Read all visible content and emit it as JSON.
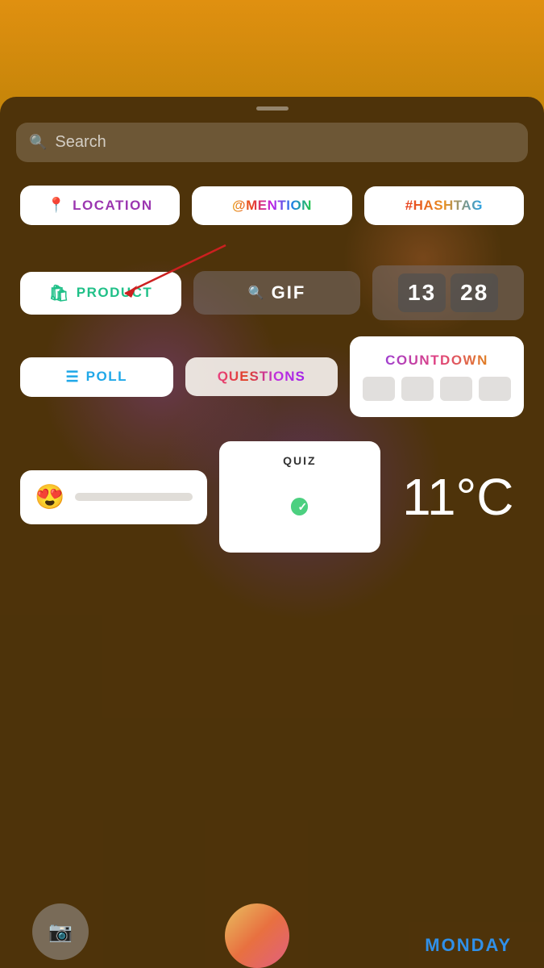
{
  "topBar": {
    "height": 120
  },
  "dragHandle": {},
  "search": {
    "placeholder": "Search",
    "icon": "🔍"
  },
  "stickers": {
    "row1": [
      {
        "id": "location",
        "label": "LOCATION",
        "icon": "📍",
        "type": "location"
      },
      {
        "id": "mention",
        "label": "@MENTION",
        "type": "mention"
      },
      {
        "id": "hashtag",
        "label": "#HASHTAG",
        "type": "hashtag"
      }
    ],
    "row2": [
      {
        "id": "product",
        "label": "PRODUCT",
        "icon": "🛍",
        "type": "product"
      },
      {
        "id": "gif",
        "label": "GIF",
        "type": "gif"
      },
      {
        "id": "timer",
        "digits1": "13",
        "digits2": "28",
        "type": "timer"
      }
    ],
    "row3": [
      {
        "id": "poll",
        "label": "POLL",
        "icon": "≡",
        "type": "poll"
      },
      {
        "id": "questions",
        "label": "QUESTIONS",
        "type": "questions"
      },
      {
        "id": "countdown",
        "label": "COUNTDOWN",
        "type": "countdown"
      }
    ],
    "row4": [
      {
        "id": "emoji-slider",
        "emoji": "😍",
        "type": "emoji-slider"
      },
      {
        "id": "quiz",
        "title": "QUIZ",
        "type": "quiz"
      },
      {
        "id": "temperature",
        "value": "11°C",
        "type": "temperature"
      }
    ]
  },
  "bottomRow": {
    "rightLabel": "MONDAY"
  }
}
